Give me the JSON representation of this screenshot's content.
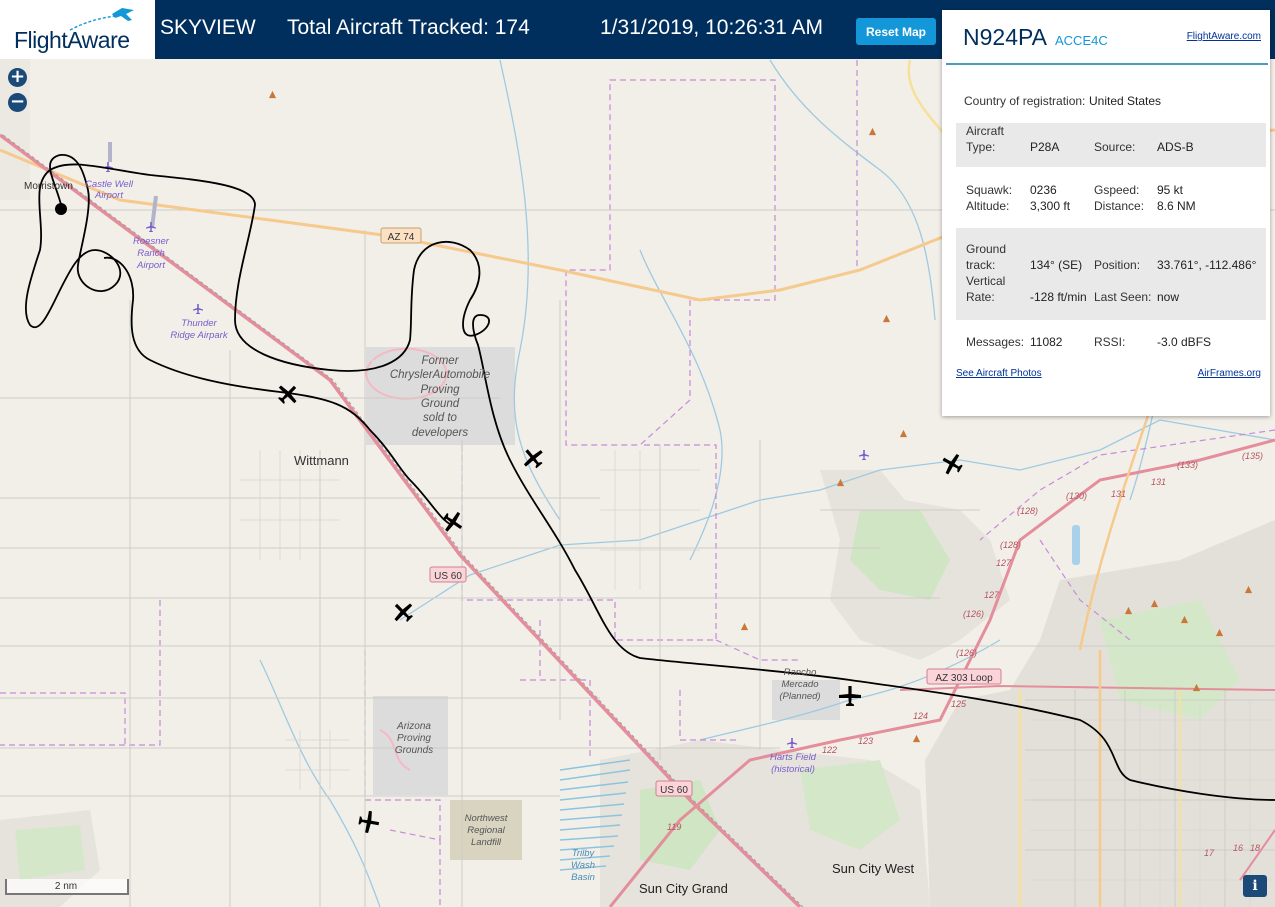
{
  "header": {
    "logo_text": "FlightAware",
    "app_title": "SKYVIEW",
    "total_aircraft": "Total Aircraft Tracked: 174",
    "datetime": "1/31/2019, 10:26:31 AM",
    "reset_button": "Reset Map"
  },
  "zoom": {
    "in": "+",
    "out": "−"
  },
  "panel": {
    "registration": "N924PA",
    "hex": "ACCE4C",
    "flightaware_link": "FlightAware.com",
    "country_label": "Country of registration:",
    "country_value": "United States",
    "aircraft_type_label_1": "Aircraft",
    "aircraft_type_label_2": "Type:",
    "aircraft_type_value": "P28A",
    "source_label": "Source:",
    "source_value": "ADS-B",
    "squawk_label": "Squawk:",
    "squawk_value": "0236",
    "altitude_label": "Altitude:",
    "altitude_value": "3,300 ft",
    "gspeed_label": "Gspeed:",
    "gspeed_value": "95 kt",
    "distance_label": "Distance:",
    "distance_value": "8.6 NM",
    "track_label_1": "Ground",
    "track_label_2": "track:",
    "track_value": "134° (SE)",
    "position_label": "Position:",
    "position_value": "33.761°, -112.486°",
    "vrate_label_1": "Vertical",
    "vrate_label_2": "Rate:",
    "vrate_value": "-128 ft/min",
    "lastseen_label": "Last Seen:",
    "lastseen_value": "now",
    "messages_label": "Messages:",
    "messages_value": "11082",
    "rssi_label": "RSSI:",
    "rssi_value": "-3.0 dBFS",
    "photos_link": "See Aircraft Photos",
    "airframes_link": "AirFrames.org"
  },
  "map": {
    "places": {
      "morristown": "Morristown",
      "wittmann": "Wittmann",
      "sun_city_grand": "Sun City Grand",
      "sun_city_west": "Sun City West"
    },
    "airports": {
      "castle_well_1": "Castle Well",
      "castle_well_2": "Airport",
      "roesner_1": "Roesner",
      "roesner_2": "Ranch",
      "roesner_3": "Airport",
      "thunder_1": "Thunder",
      "thunder_2": "Ridge Airpark",
      "harts_1": "Harts Field",
      "harts_2": "(historical)"
    },
    "areas": {
      "chrysler_1": "Former",
      "chrysler_2": "ChryslerAutomobile",
      "chrysler_3": "Proving",
      "chrysler_4": "Ground",
      "chrysler_5": "sold to",
      "chrysler_6": "developers",
      "arizona_1": "Arizona",
      "arizona_2": "Proving",
      "arizona_3": "Grounds",
      "landfill_1": "Northwest",
      "landfill_2": "Regional",
      "landfill_3": "Landfill",
      "rancho_1": "Rancho",
      "rancho_2": "Mercado",
      "rancho_3": "(Planned)",
      "trilby_1": "Trilby",
      "trilby_2": "Wash",
      "trilby_3": "Basin"
    },
    "roads": {
      "az74": "AZ 74",
      "us60_a": "US 60",
      "us60_b": "US 60",
      "az303": "AZ 303 Loop",
      "r133": "(133)",
      "r135": "(135)",
      "r130": "(130)",
      "r131a": "131",
      "r131b": "131",
      "r128a": "(128)",
      "r128b": "(128)",
      "r127a": "127",
      "r127b": "127",
      "r126a": "(126)",
      "r126b": "(126)",
      "r125": "125",
      "r124": "124",
      "r123": "123",
      "r122": "122",
      "r119": "119",
      "r17": "17",
      "r16": "16",
      "r18": "18"
    },
    "scale": "2 nm",
    "info": "i"
  },
  "colors": {
    "header_bg": "#002f5d",
    "accent": "#1497d8",
    "track_line": "#000000",
    "highway": "#e48e9c",
    "az74_road": "#f6c98d",
    "boundary": "#c88ad8",
    "water": "#9ecae1"
  }
}
